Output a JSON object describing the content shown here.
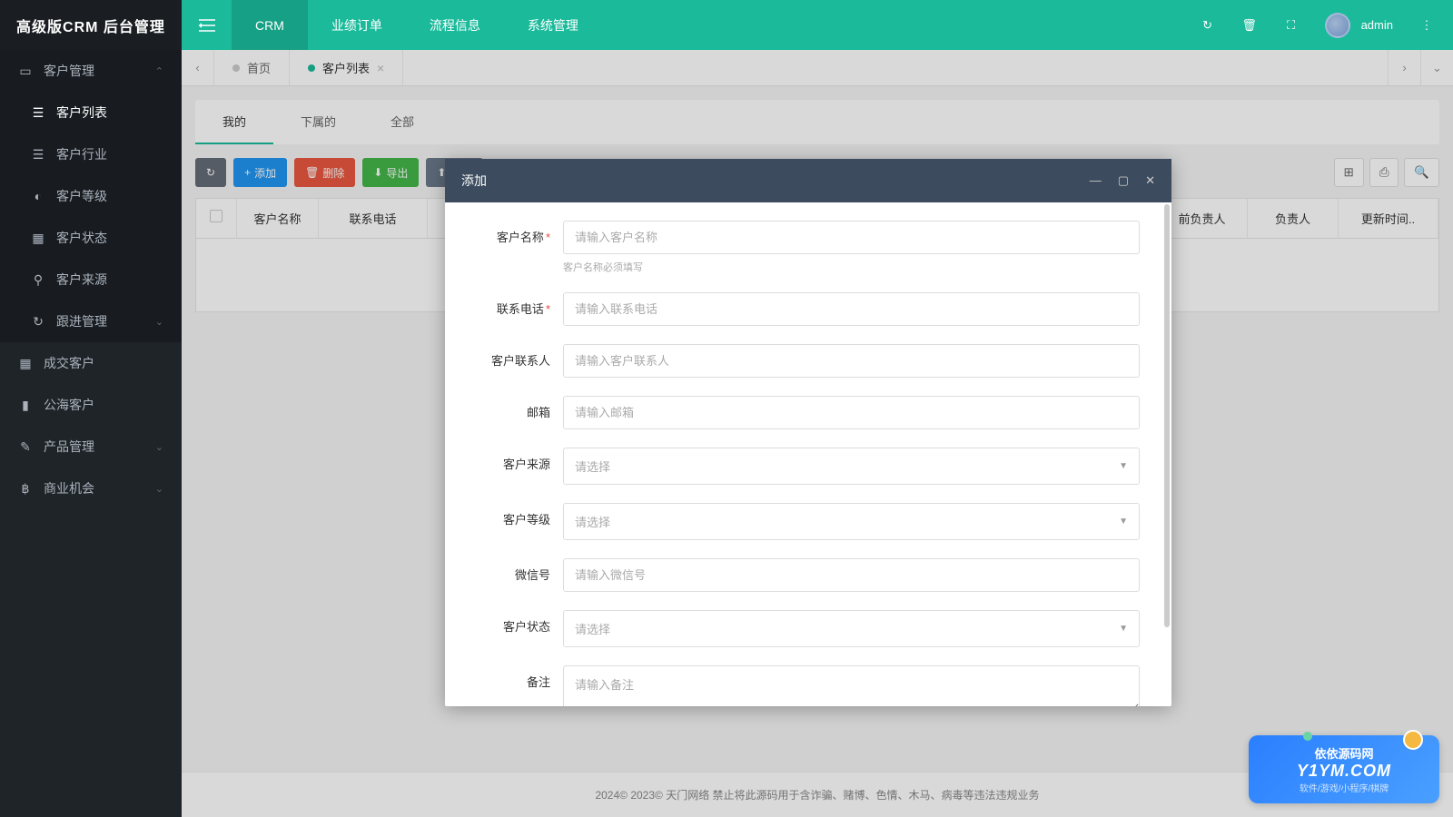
{
  "app": {
    "name": "高级版CRM 后台管理"
  },
  "header": {
    "navs": [
      "CRM",
      "业绩订单",
      "流程信息",
      "系统管理"
    ],
    "user": "admin"
  },
  "sidebar": {
    "items": [
      {
        "label": "客户管理",
        "icon": "👥",
        "type": "group",
        "open": true
      },
      {
        "label": "客户列表",
        "icon": "☰",
        "type": "sub",
        "active": true
      },
      {
        "label": "客户行业",
        "icon": "☰",
        "type": "sub"
      },
      {
        "label": "客户等级",
        "icon": "◐",
        "type": "sub"
      },
      {
        "label": "客户状态",
        "icon": "▦",
        "type": "sub"
      },
      {
        "label": "客户来源",
        "icon": "⚲",
        "type": "sub"
      },
      {
        "label": "跟进管理",
        "icon": "↻",
        "type": "sub-group"
      },
      {
        "label": "成交客户",
        "icon": "▦",
        "type": "item"
      },
      {
        "label": "公海客户",
        "icon": "▮",
        "type": "item"
      },
      {
        "label": "产品管理",
        "icon": "✎",
        "type": "group"
      },
      {
        "label": "商业机会",
        "icon": "฿",
        "type": "group"
      }
    ]
  },
  "tabs": {
    "home": "首页",
    "active": "客户列表"
  },
  "filters": [
    "我的",
    "下属的",
    "全部"
  ],
  "toolbar": {
    "refresh": "↻",
    "add": "添加",
    "delete": "删除",
    "export": "导出",
    "import": "导入"
  },
  "table": {
    "columns": [
      "客户名称",
      "联系电话",
      "前负责人",
      "负责人",
      "更新时间.."
    ]
  },
  "modal": {
    "title": "添加",
    "fields": {
      "name": {
        "label": "客户名称",
        "placeholder": "请输入客户名称",
        "required": true,
        "help": "客户名称必须填写"
      },
      "phone": {
        "label": "联系电话",
        "placeholder": "请输入联系电话",
        "required": true
      },
      "contact": {
        "label": "客户联系人",
        "placeholder": "请输入客户联系人"
      },
      "email": {
        "label": "邮箱",
        "placeholder": "请输入邮箱"
      },
      "source": {
        "label": "客户来源",
        "placeholder": "请选择"
      },
      "level": {
        "label": "客户等级",
        "placeholder": "请选择"
      },
      "wechat": {
        "label": "微信号",
        "placeholder": "请输入微信号"
      },
      "status": {
        "label": "客户状态",
        "placeholder": "请选择"
      },
      "remark": {
        "label": "备注",
        "placeholder": "请输入备注"
      }
    }
  },
  "footer": "2024© 2023© 天门网络 禁止将此源码用于含诈骗、赌博、色情、木马、病毒等违法违规业务",
  "watermark": {
    "title": "依依源码网",
    "domain": "Y1YM.COM",
    "sub": "软件/游戏/小程序/棋牌"
  }
}
